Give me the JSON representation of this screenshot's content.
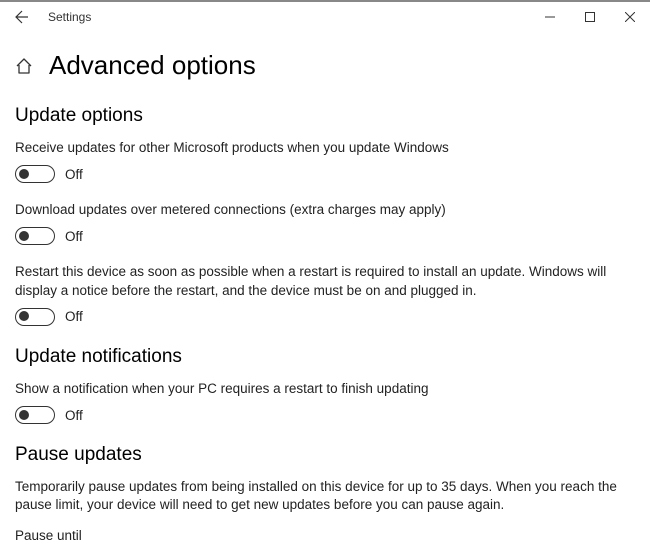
{
  "titlebar": {
    "title": "Settings"
  },
  "header": {
    "title": "Advanced options"
  },
  "sections": {
    "update_options": {
      "heading": "Update options",
      "opt1_desc": "Receive updates for other Microsoft products when you update Windows",
      "opt1_state": "Off",
      "opt2_desc": "Download updates over metered connections (extra charges may apply)",
      "opt2_state": "Off",
      "opt3_desc": "Restart this device as soon as possible when a restart is required to install an update. Windows will display a notice before the restart, and the device must be on and plugged in.",
      "opt3_state": "Off"
    },
    "update_notifications": {
      "heading": "Update notifications",
      "opt1_desc": "Show a notification when your PC requires a restart to finish updating",
      "opt1_state": "Off"
    },
    "pause_updates": {
      "heading": "Pause updates",
      "desc": "Temporarily pause updates from being installed on this device for up to 35 days. When you reach the pause limit, your device will need to get new updates before you can pause again.",
      "label": "Pause until"
    }
  }
}
